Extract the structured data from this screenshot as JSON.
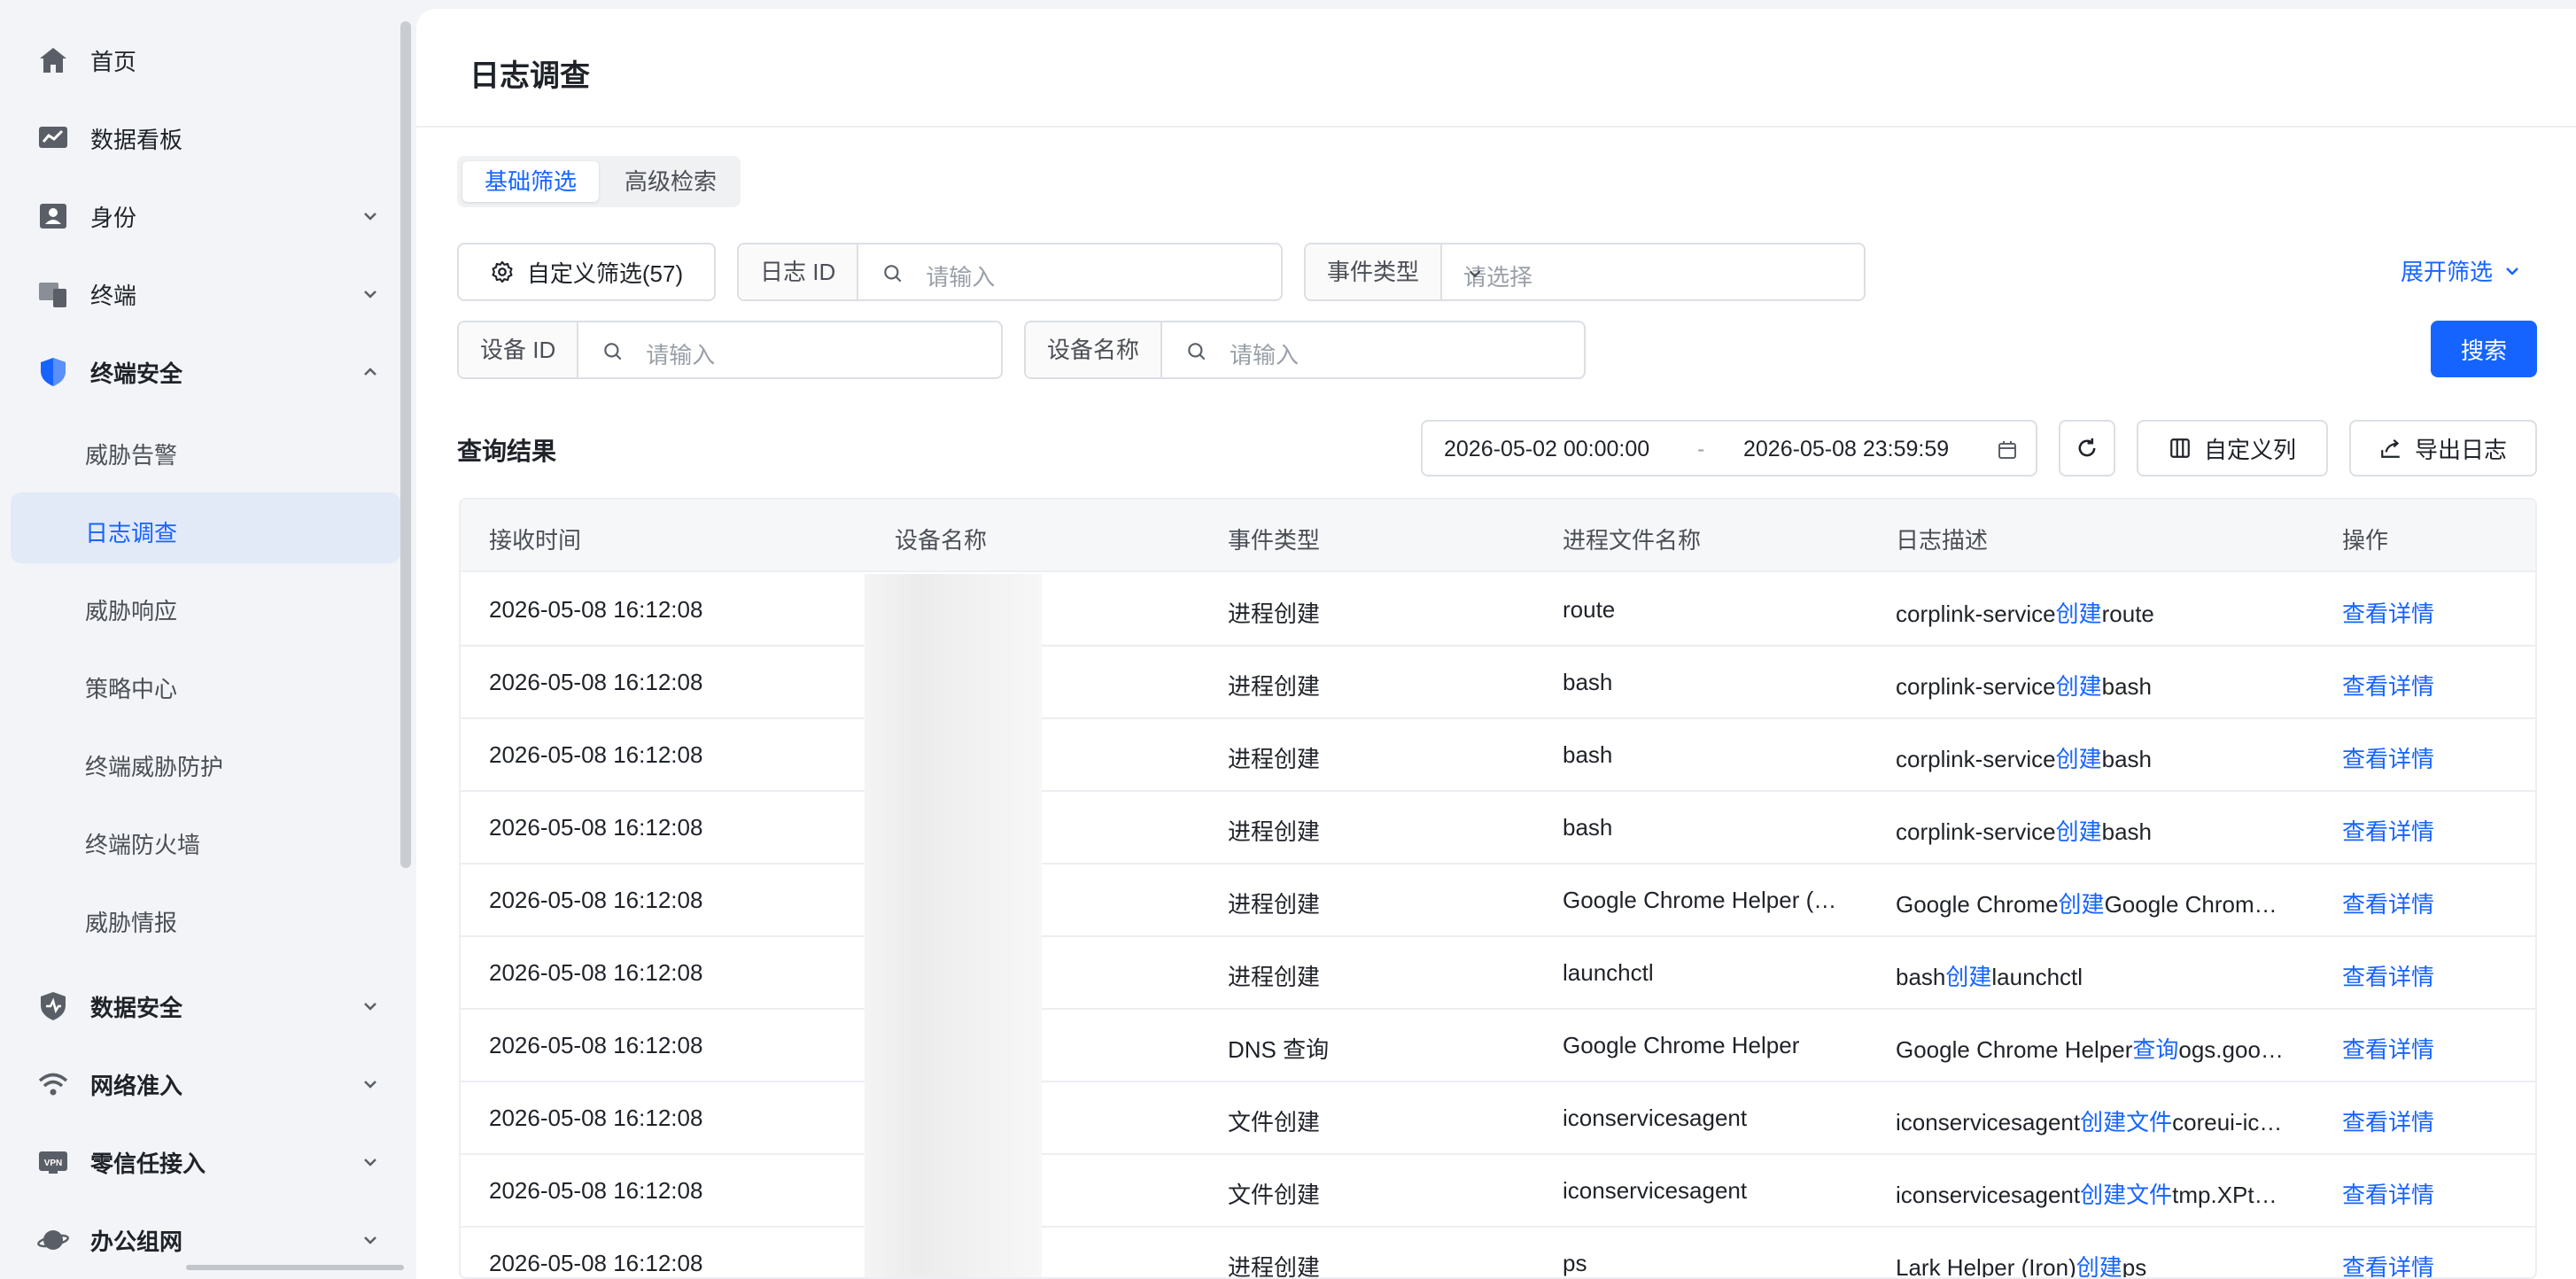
{
  "sidebar": {
    "items": [
      {
        "label": "首页",
        "icon": "home-icon"
      },
      {
        "label": "数据看板",
        "icon": "dashboard-icon"
      },
      {
        "label": "身份",
        "icon": "identity-icon"
      },
      {
        "label": "终端",
        "icon": "device-icon"
      },
      {
        "label": "终端安全",
        "icon": "shield-icon"
      },
      {
        "label": "数据安全",
        "icon": "data-security-icon"
      },
      {
        "label": "网络准入",
        "icon": "wifi-icon"
      },
      {
        "label": "零信任接入",
        "icon": "vpn-icon"
      },
      {
        "label": "办公组网",
        "icon": "planet-icon"
      }
    ],
    "vpn_badge": "VPN",
    "sub_items": [
      "威胁告警",
      "日志调查",
      "威胁响应",
      "策略中心",
      "终端威胁防护",
      "终端防火墙",
      "威胁情报"
    ],
    "active_sub": "日志调查"
  },
  "header": {
    "title": "日志调查"
  },
  "filter": {
    "tabs": [
      "基础筛选",
      "高级检索"
    ],
    "custom_filter_label": "自定义筛选(57)",
    "log_id": {
      "label": "日志 ID",
      "placeholder": "请输入"
    },
    "event_type": {
      "label": "事件类型",
      "placeholder": "请选择"
    },
    "device_id": {
      "label": "设备 ID",
      "placeholder": "请输入"
    },
    "device_name": {
      "label": "设备名称",
      "placeholder": "请输入"
    },
    "expand_label": "展开筛选",
    "search_label": "搜索"
  },
  "results": {
    "title": "查询结果",
    "date_start": "2026-05-02 00:00:00",
    "date_sep": "-",
    "date_end": "2026-05-08 23:59:59",
    "custom_columns_label": "自定义列",
    "export_label": "导出日志"
  },
  "table": {
    "columns": [
      "接收时间",
      "设备名称",
      "事件类型",
      "进程文件名称",
      "日志描述",
      "操作"
    ],
    "action_label": "查看详情",
    "rows": [
      {
        "time": "2026-05-08 16:12:08",
        "event": "进程创建",
        "process": "route",
        "desc": [
          "corplink-service",
          "创建",
          "route"
        ]
      },
      {
        "time": "2026-05-08 16:12:08",
        "event": "进程创建",
        "process": "bash",
        "desc": [
          "corplink-service",
          "创建",
          "bash"
        ]
      },
      {
        "time": "2026-05-08 16:12:08",
        "event": "进程创建",
        "process": "bash",
        "desc": [
          "corplink-service",
          "创建",
          "bash"
        ]
      },
      {
        "time": "2026-05-08 16:12:08",
        "event": "进程创建",
        "process": "bash",
        "desc": [
          "corplink-service",
          "创建",
          "bash"
        ]
      },
      {
        "time": "2026-05-08 16:12:08",
        "event": "进程创建",
        "process": "Google Chrome Helper (…",
        "desc": [
          "Google Chrome",
          "创建",
          "Google Chrom…"
        ]
      },
      {
        "time": "2026-05-08 16:12:08",
        "event": "进程创建",
        "process": "launchctl",
        "desc": [
          "bash",
          "创建",
          "launchctl"
        ]
      },
      {
        "time": "2026-05-08 16:12:08",
        "event": "DNS 查询",
        "process": "Google Chrome Helper",
        "desc": [
          "Google Chrome Helper",
          "查询",
          "ogs.goo…"
        ]
      },
      {
        "time": "2026-05-08 16:12:08",
        "event": "文件创建",
        "process": "iconservicesagent",
        "desc": [
          "iconservicesagent",
          "创建文件",
          "coreui-ic…"
        ]
      },
      {
        "time": "2026-05-08 16:12:08",
        "event": "文件创建",
        "process": "iconservicesagent",
        "desc": [
          "iconservicesagent",
          "创建文件",
          "tmp.XPt…"
        ]
      },
      {
        "time": "2026-05-08 16:12:08",
        "event": "进程创建",
        "process": "ps",
        "desc": [
          "Lark Helper (Iron)",
          "创建",
          "ps"
        ]
      }
    ]
  }
}
